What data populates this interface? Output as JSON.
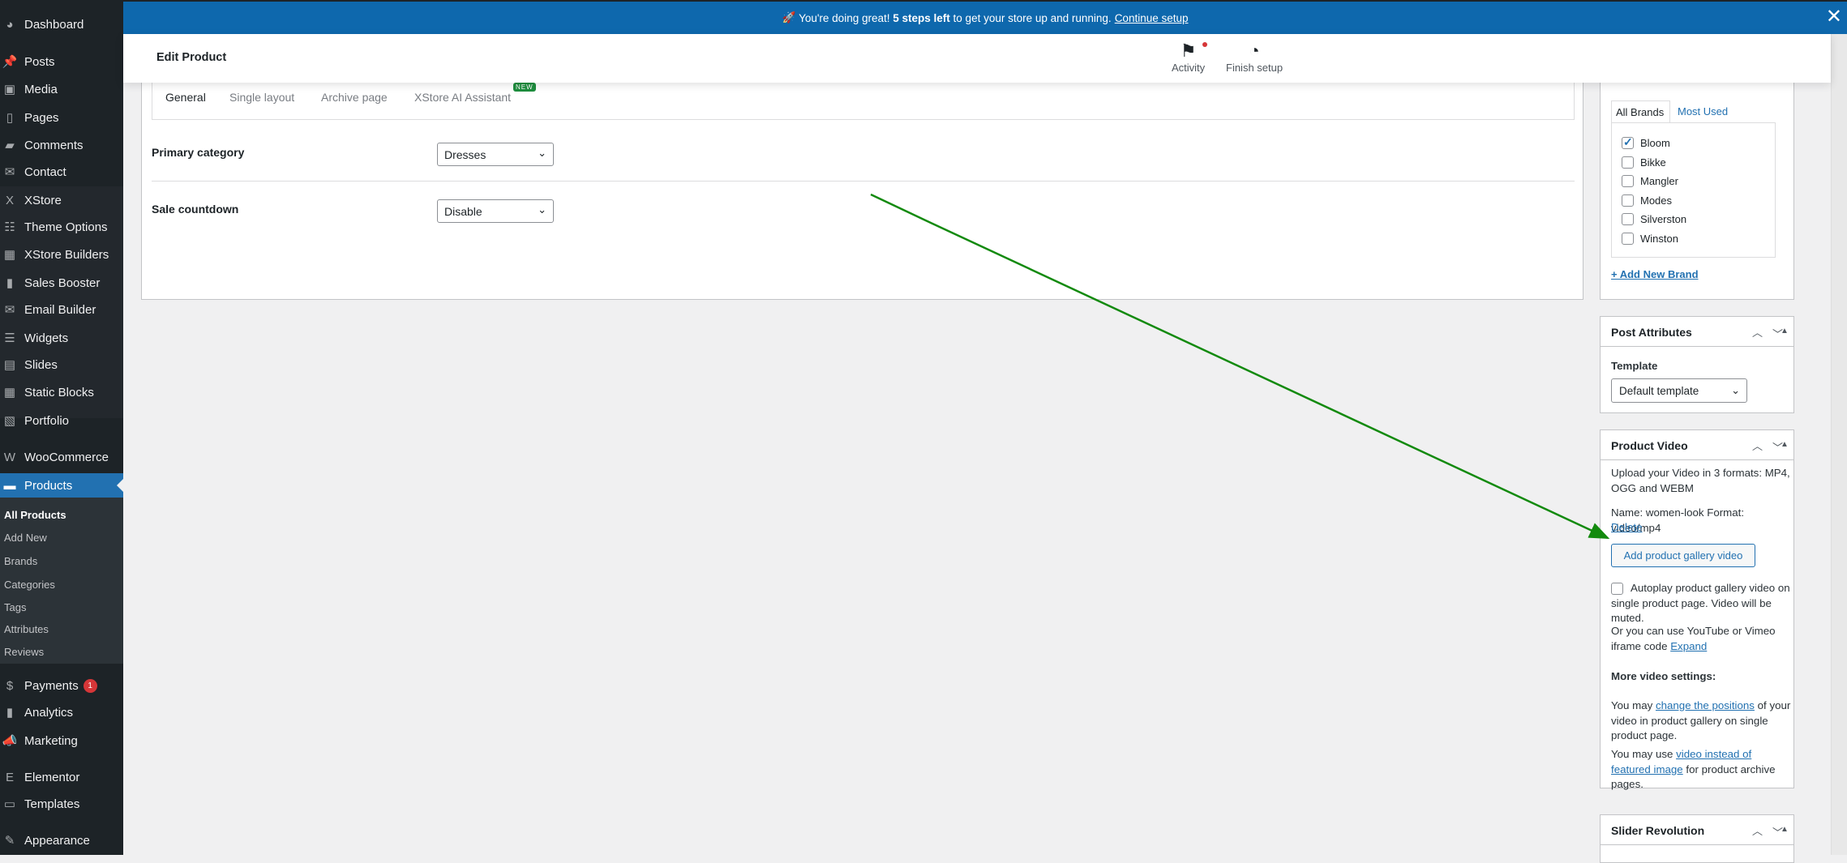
{
  "banner": {
    "emoji": "🚀",
    "text_before": "You're doing great!",
    "bold": "5 steps left",
    "text_after": "to get your store up and running.",
    "link": "Continue setup",
    "close": "✕"
  },
  "header": {
    "title": "Edit Product",
    "activity": "Activity",
    "finish_setup": "Finish setup"
  },
  "sidebar": {
    "items": [
      {
        "label": "Dashboard",
        "icon": "◕"
      },
      {
        "label": "Posts",
        "icon": "📌"
      },
      {
        "label": "Media",
        "icon": "▣"
      },
      {
        "label": "Pages",
        "icon": "▯"
      },
      {
        "label": "Comments",
        "icon": "▰"
      },
      {
        "label": "Contact",
        "icon": "✉"
      },
      {
        "label": "XStore",
        "icon": "X"
      },
      {
        "label": "Theme Options",
        "icon": "☷"
      },
      {
        "label": "XStore Builders",
        "icon": "▦"
      },
      {
        "label": "Sales Booster",
        "icon": "▮"
      },
      {
        "label": "Email Builder",
        "icon": "✉"
      },
      {
        "label": "Widgets",
        "icon": "☰"
      },
      {
        "label": "Slides",
        "icon": "▤"
      },
      {
        "label": "Static Blocks",
        "icon": "▦"
      },
      {
        "label": "Portfolio",
        "icon": "▧"
      },
      {
        "label": "WooCommerce",
        "icon": "W"
      },
      {
        "label": "Products",
        "icon": "▬"
      },
      {
        "label": "Payments",
        "icon": "$",
        "badge": "1"
      },
      {
        "label": "Analytics",
        "icon": "▮"
      },
      {
        "label": "Marketing",
        "icon": "📣"
      },
      {
        "label": "Elementor",
        "icon": "E"
      },
      {
        "label": "Templates",
        "icon": "▭"
      },
      {
        "label": "Appearance",
        "icon": "✎"
      }
    ],
    "submenu": [
      "All Products",
      "Add New",
      "Brands",
      "Categories",
      "Tags",
      "Attributes",
      "Reviews"
    ]
  },
  "main": {
    "tabs": [
      "General",
      "Single layout",
      "Archive page",
      "XStore AI Assistant"
    ],
    "new_badge": "NEW",
    "fields": [
      {
        "label": "Primary category",
        "value": "Dresses"
      },
      {
        "label": "Sale countdown",
        "value": "Disable"
      }
    ]
  },
  "brands": {
    "tabs": [
      "All Brands",
      "Most Used"
    ],
    "items": [
      {
        "name": "Bloom",
        "checked": true
      },
      {
        "name": "Bikke",
        "checked": false
      },
      {
        "name": "Mangler",
        "checked": false
      },
      {
        "name": "Modes",
        "checked": false
      },
      {
        "name": "Silverston",
        "checked": false
      },
      {
        "name": "Winston",
        "checked": false
      }
    ],
    "add_new": "+ Add New Brand"
  },
  "post_attributes": {
    "title": "Post Attributes",
    "template_label": "Template",
    "template_value": "Default template"
  },
  "product_video": {
    "title": "Product Video",
    "upload_text": "Upload your Video in 3 formats: MP4, OGG and WEBM",
    "name_text": "Name: women-look Format: video/mp4",
    "delete": "Delete",
    "add_button": "Add product gallery video",
    "autoplay": "Autoplay product gallery video on single product page. Video will be muted.",
    "iframe_text": "Or you can use YouTube or Vimeo iframe code",
    "expand": "Expand",
    "more_heading": "More video settings:",
    "p1_before": "You may",
    "p1_link": "change the positions",
    "p1_after": "of your video in product gallery on single product page.",
    "p2_before": "You may use",
    "p2_link": "video instead of featured image",
    "p2_after": "for product archive pages."
  },
  "slider_revolution": {
    "title": "Slider Revolution"
  },
  "annotation": {
    "arrow_color": "#138a0e"
  },
  "colors": {
    "accent": "#2271b1",
    "banner": "#0e68ad",
    "sidebar": "#1d2327"
  }
}
